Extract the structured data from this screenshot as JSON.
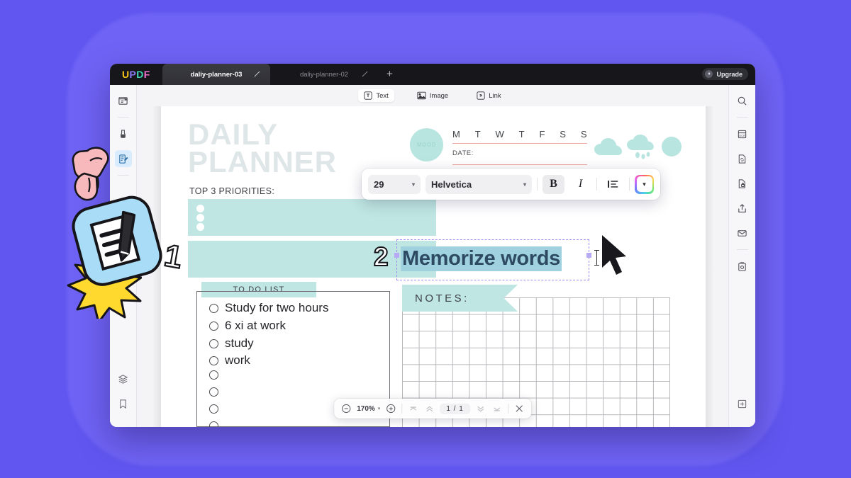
{
  "window": {
    "logo": {
      "l1": "U",
      "l2": "P",
      "l3": "D",
      "l4": "F"
    },
    "tabs": [
      {
        "label": "daliy-planner-03",
        "active": true,
        "edit_icon": "pencil-icon"
      },
      {
        "label": "daliy-planner-02",
        "active": false,
        "edit_icon": "pencil-icon"
      }
    ],
    "add_tab_label": "+",
    "upgrade_label": "Upgrade",
    "upgrade_icon": "crown-icon"
  },
  "rail_left": {
    "items": [
      {
        "name": "reader-mode-icon",
        "selected": false
      },
      {
        "name": "comment-markup-icon",
        "selected": false
      },
      {
        "name": "edit-pdf-icon",
        "selected": true
      }
    ],
    "bottom_items": [
      {
        "name": "layers-icon"
      },
      {
        "name": "bookmark-icon"
      }
    ]
  },
  "rail_right": {
    "items": [
      {
        "name": "search-icon"
      },
      {
        "name": "ocr-icon"
      },
      {
        "name": "convert-icon"
      },
      {
        "name": "protect-icon"
      },
      {
        "name": "share-icon"
      },
      {
        "name": "email-icon"
      },
      {
        "name": "batch-icon"
      }
    ],
    "bottom_items": [
      {
        "name": "compress-icon"
      }
    ]
  },
  "edit_toolbar": {
    "items": [
      {
        "label": "Text",
        "icon": "text-box-icon",
        "selected": true
      },
      {
        "label": "Image",
        "icon": "image-icon",
        "selected": false
      },
      {
        "label": "Link",
        "icon": "link-icon",
        "selected": false
      }
    ]
  },
  "font_toolbar": {
    "size_value": "29",
    "family_value": "Helvetica",
    "bold_label": "B",
    "bold_active": true,
    "italic_label": "I",
    "italic_active": false,
    "align_icon": "align-left-icon",
    "color_icon": "chevron-down-icon",
    "dropdown_caret": "▾"
  },
  "document": {
    "title_line1": "DAILY",
    "title_line2": "PLANNER",
    "priorities_label": "TOP 3 PRIORITIES:",
    "mood_label": "MOOD",
    "week_days": [
      "M",
      "T",
      "W",
      "T",
      "F",
      "S",
      "S"
    ],
    "date_label": "DATE:",
    "weather_icons": [
      "cloud-icon",
      "rain-cloud-icon",
      "sun-cloud-icon"
    ],
    "selected_text": "Memorize words",
    "todo_banner": "TO DO LIST",
    "todo_items": [
      "Study for two hours",
      "6 xi at work",
      "study",
      "work",
      "",
      "",
      "",
      "",
      ""
    ],
    "notes_banner": "NOTES:"
  },
  "zoombar": {
    "zoom_out_icon": "minus-circle-icon",
    "zoom_level": "170%",
    "zoom_caret": "▾",
    "zoom_in_icon": "plus-circle-icon",
    "first_page_icon": "chevron-up-single-icon",
    "prev_page_icon": "chevron-up-double-icon",
    "page_current": "1",
    "page_sep": "/",
    "page_total": "1",
    "next_page_icon": "chevron-down-double-icon",
    "last_page_icon": "chevron-down-single-icon",
    "close_icon": "close-icon"
  },
  "annotations": {
    "step_one": "1",
    "step_two": "2",
    "hand_icon": "pointing-hand-icon",
    "badge_icon": "edit-document-badge-icon",
    "starburst_icon": "starburst-icon",
    "cursor_icon": "mouse-cursor-icon"
  },
  "colors": {
    "background": "#6156f0",
    "accent_teal": "#bfe6e2",
    "selection_purple": "#9b8df0",
    "text_select": "#9fd2de"
  }
}
